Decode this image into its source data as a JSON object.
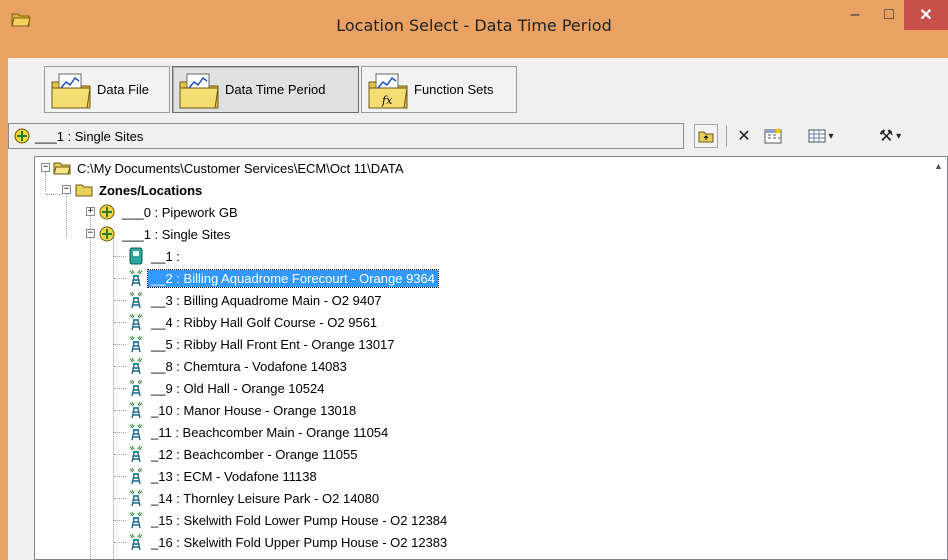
{
  "window": {
    "title": "Location Select - Data Time Period",
    "minimize_glyph": "–",
    "maximize_glyph": "□",
    "close_glyph": "✕"
  },
  "toolbar": {
    "buttons": [
      {
        "label": "Data File",
        "icon": "folder-chart-icon",
        "active": false
      },
      {
        "label": "Data Time Period",
        "icon": "folder-chart-icon",
        "active": true
      },
      {
        "label": "Function Sets",
        "icon": "folder-function-icon",
        "active": false
      }
    ]
  },
  "pathbar": {
    "current_site": "___1 : Single Sites",
    "icons": [
      "up-folder-icon",
      "delete-icon",
      "calendar-icon",
      "grid-menu-icon",
      "tools-menu-icon"
    ],
    "delete_glyph": "✕",
    "tools_glyph": "⚒",
    "dropdown_glyph": "▾"
  },
  "tree": {
    "root": "C:\\My Documents\\Customer Services\\ECM\\Oct 11\\DATA",
    "zones": "Zones/Locations",
    "groups": [
      {
        "label": "___0 : Pipework GB",
        "expanded": false
      },
      {
        "label": "___1 : Single Sites",
        "expanded": true
      }
    ],
    "sites": [
      {
        "label": "__1 :",
        "icon": "meter-icon"
      },
      {
        "label": "__2 : Billing Aquadrome Forecourt - Orange 9364",
        "icon": "radio-mast-icon",
        "selected": true
      },
      {
        "label": "__3 : Billing Aquadrome Main - O2 9407",
        "icon": "radio-mast-icon"
      },
      {
        "label": "__4 : Ribby Hall Golf Course - O2 9561",
        "icon": "radio-mast-icon"
      },
      {
        "label": "__5 : Ribby Hall Front Ent - Orange 13017",
        "icon": "radio-mast-icon"
      },
      {
        "label": "__8 : Chemtura - Vodafone 14083",
        "icon": "radio-mast-icon"
      },
      {
        "label": "__9 : Old Hall - Orange 10524",
        "icon": "radio-mast-icon"
      },
      {
        "label": "_10 : Manor House - Orange 13018",
        "icon": "radio-mast-icon"
      },
      {
        "label": "_11 : Beachcomber Main - Orange 11054",
        "icon": "radio-mast-icon"
      },
      {
        "label": "_12 : Beachcomber - Orange 11055",
        "icon": "radio-mast-icon"
      },
      {
        "label": "_13 : ECM - Vodafone 11138",
        "icon": "radio-mast-icon"
      },
      {
        "label": "_14 : Thornley Leisure Park - O2 14080",
        "icon": "radio-mast-icon"
      },
      {
        "label": "_15 : Skelwith Fold Lower Pump House - O2 12384",
        "icon": "radio-mast-icon"
      },
      {
        "label": "_16 : Skelwith Fold Upper Pump House - O2 12383",
        "icon": "radio-mast-icon"
      }
    ]
  },
  "colors": {
    "title_bar": "#e9a264",
    "close_button": "#c7504b",
    "selection": "#3399ff"
  }
}
